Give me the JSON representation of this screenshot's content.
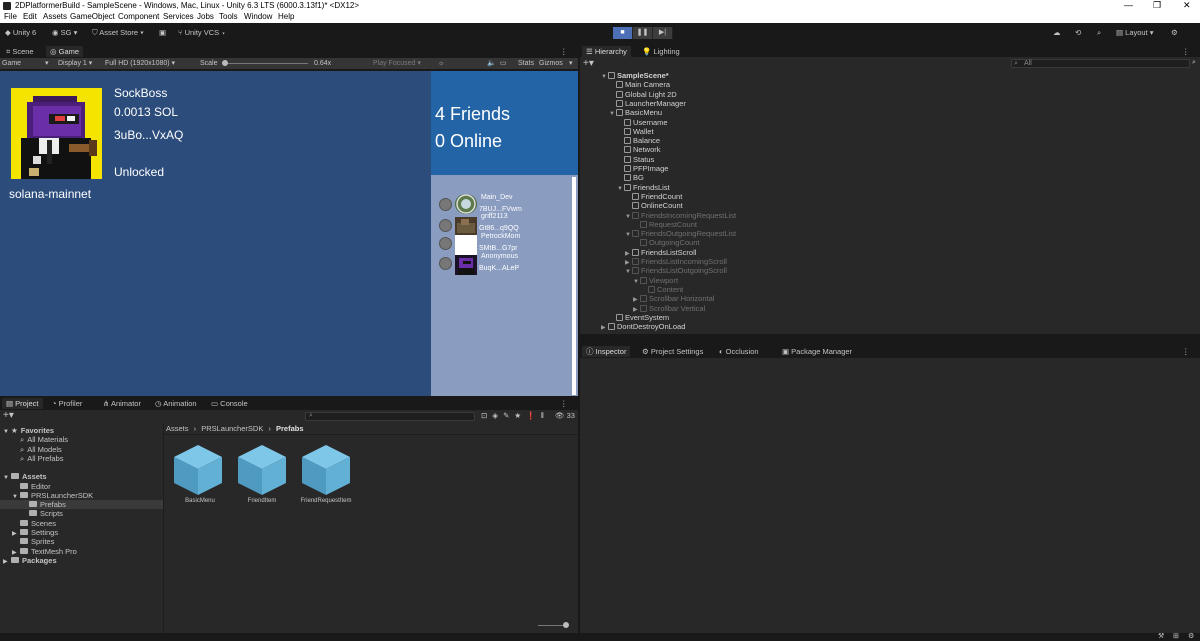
{
  "window": {
    "title": "2DPlatformerBuild - SampleScene - Windows, Mac, Linux - Unity 6.3 LTS (6000.3.13f1)* <DX12>",
    "controls": [
      "—",
      "❐",
      "✕"
    ]
  },
  "menu": [
    "File",
    "Edit",
    "Assets",
    "GameObject",
    "Component",
    "Services",
    "Jobs",
    "Tools",
    "Window",
    "Help"
  ],
  "toolbar": {
    "account": "Unity 6",
    "user": "SG",
    "asset_store": "Asset Store",
    "vcs": "Unity VCS",
    "layout": "Layout"
  },
  "scene_tabs": [
    "Scene",
    "Game"
  ],
  "game_bar": {
    "view": "Game",
    "display": "Display 1",
    "resolution": "Full HD (1920x1080)",
    "scale_label": "Scale",
    "scale_value": "0.64x",
    "play_focused": "Play Focused",
    "stats": "Stats",
    "gizmos": "Gizmos"
  },
  "game": {
    "username": "SockBoss",
    "balance": "0.0013 SOL",
    "wallet": "3uBo...VxAQ",
    "status": "Unlocked",
    "network": "solana-mainnet",
    "friend_count": "4 Friends",
    "online_count": "0 Online",
    "friends": [
      {
        "name": "Main_Dev",
        "wallet": "7BUJ...FVwm"
      },
      {
        "name": "griff2113",
        "wallet": "Gt86...q9QQ"
      },
      {
        "name": "PetrockMom",
        "wallet": "SMtB...G7pr"
      },
      {
        "name": "Anonymous",
        "wallet": "BuqK...ALeP"
      }
    ]
  },
  "right_tabs": [
    "Hierarchy",
    "Lighting"
  ],
  "hierarchy": {
    "search_placeholder": "All",
    "rows": [
      {
        "label": "SampleScene*",
        "depth": 0,
        "dim": false,
        "arrow": "▼",
        "bold": true
      },
      {
        "label": "Main Camera",
        "depth": 1,
        "dim": false,
        "arrow": ""
      },
      {
        "label": "Global Light 2D",
        "depth": 1,
        "dim": false,
        "arrow": ""
      },
      {
        "label": "LauncherManager",
        "depth": 1,
        "dim": false,
        "arrow": ""
      },
      {
        "label": "BasicMenu",
        "depth": 1,
        "dim": false,
        "arrow": "▼"
      },
      {
        "label": "Username",
        "depth": 2,
        "dim": false,
        "arrow": ""
      },
      {
        "label": "Wallet",
        "depth": 2,
        "dim": false,
        "arrow": ""
      },
      {
        "label": "Balance",
        "depth": 2,
        "dim": false,
        "arrow": ""
      },
      {
        "label": "Network",
        "depth": 2,
        "dim": false,
        "arrow": ""
      },
      {
        "label": "Status",
        "depth": 2,
        "dim": false,
        "arrow": ""
      },
      {
        "label": "PFPImage",
        "depth": 2,
        "dim": false,
        "arrow": ""
      },
      {
        "label": "BG",
        "depth": 2,
        "dim": false,
        "arrow": ""
      },
      {
        "label": "FriendsList",
        "depth": 2,
        "dim": false,
        "arrow": "▼"
      },
      {
        "label": "FriendCount",
        "depth": 3,
        "dim": false,
        "arrow": ""
      },
      {
        "label": "OnlineCount",
        "depth": 3,
        "dim": false,
        "arrow": ""
      },
      {
        "label": "FriendsIncomingRequestList",
        "depth": 3,
        "dim": true,
        "arrow": "▼"
      },
      {
        "label": "RequestCount",
        "depth": 4,
        "dim": true,
        "arrow": ""
      },
      {
        "label": "FriendsOutgoingRequestList",
        "depth": 3,
        "dim": true,
        "arrow": "▼"
      },
      {
        "label": "OutgoingCount",
        "depth": 4,
        "dim": true,
        "arrow": ""
      },
      {
        "label": "FriendsListScroll",
        "depth": 3,
        "dim": false,
        "arrow": "▶"
      },
      {
        "label": "FriendsListIncomingScroll",
        "depth": 3,
        "dim": true,
        "arrow": "▶"
      },
      {
        "label": "FriendsListOutgoingScroll",
        "depth": 3,
        "dim": true,
        "arrow": "▼"
      },
      {
        "label": "Viewport",
        "depth": 4,
        "dim": true,
        "arrow": "▼"
      },
      {
        "label": "Content",
        "depth": 5,
        "dim": true,
        "arrow": ""
      },
      {
        "label": "Scrollbar Horizontal",
        "depth": 4,
        "dim": true,
        "arrow": "▶"
      },
      {
        "label": "Scrollbar Vertical",
        "depth": 4,
        "dim": true,
        "arrow": "▶"
      },
      {
        "label": "EventSystem",
        "depth": 1,
        "dim": false,
        "arrow": ""
      },
      {
        "label": "DontDestroyOnLoad",
        "depth": 0,
        "dim": false,
        "arrow": "▶"
      }
    ]
  },
  "inspector_tabs": [
    "Inspector",
    "Project Settings",
    "Occlusion",
    "Package Manager"
  ],
  "bottom_tabs": [
    "Project",
    "Profiler",
    "Animator",
    "Animation",
    "Console"
  ],
  "project": {
    "hidden_count": "33",
    "breadcrumb": [
      "Assets",
      "PRSLauncherSDK",
      "Prefabs"
    ],
    "tree": [
      {
        "label": "Favorites",
        "depth": 0,
        "type": "star",
        "arrow": "▼",
        "bold": true
      },
      {
        "label": "All Materials",
        "depth": 1,
        "type": "search"
      },
      {
        "label": "All Models",
        "depth": 1,
        "type": "search"
      },
      {
        "label": "All Prefabs",
        "depth": 1,
        "type": "search"
      },
      {
        "label": "Assets",
        "depth": 0,
        "type": "folder",
        "arrow": "▼",
        "bold": true
      },
      {
        "label": "Editor",
        "depth": 1,
        "type": "folder"
      },
      {
        "label": "PRSLauncherSDK",
        "depth": 1,
        "type": "folder",
        "arrow": "▼"
      },
      {
        "label": "Prefabs",
        "depth": 2,
        "type": "folder",
        "selected": true
      },
      {
        "label": "Scripts",
        "depth": 2,
        "type": "folder"
      },
      {
        "label": "Scenes",
        "depth": 1,
        "type": "folder"
      },
      {
        "label": "Settings",
        "depth": 1,
        "type": "folder",
        "arrow": "▶"
      },
      {
        "label": "Sprites",
        "depth": 1,
        "type": "folder"
      },
      {
        "label": "TextMesh Pro",
        "depth": 1,
        "type": "folder",
        "arrow": "▶"
      },
      {
        "label": "Packages",
        "depth": 0,
        "type": "folder",
        "arrow": "▶",
        "bold": true
      }
    ],
    "assets": [
      "BasicMenu",
      "FriendItem",
      "FriendRequestItem"
    ]
  }
}
